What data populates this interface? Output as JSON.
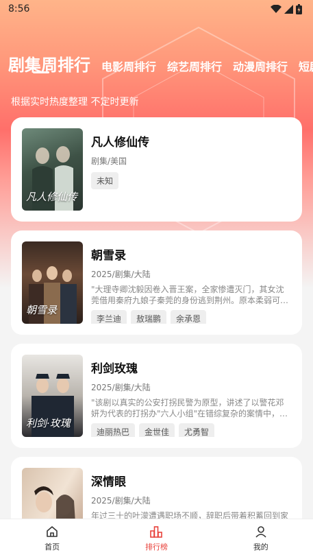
{
  "status_bar": {
    "time": "8:56"
  },
  "tabs": [
    {
      "label": "剧集周排行",
      "active": true
    },
    {
      "label": "电影周排行",
      "active": false
    },
    {
      "label": "综艺周排行",
      "active": false
    },
    {
      "label": "动漫周排行",
      "active": false
    },
    {
      "label": "短剧",
      "active": false
    }
  ],
  "subtitle": "根据实时热度整理 不定时更新",
  "items": [
    {
      "title": "凡人修仙传",
      "meta": "剧集/美国",
      "desc": "",
      "poster_text": "凡人修仙传",
      "tags": [
        "未知"
      ]
    },
    {
      "title": "朝雪录",
      "meta": "2025/剧集/大陆",
      "desc": "\"大理寺卿沈毅因卷入晋王案，全家惨遭灭门，其女沈莞借用秦府九娘子秦莞的身份逃到荆州。原本柔弱可…",
      "poster_text": "朝雪录",
      "tags": [
        "李兰迪",
        "敖瑞鹏",
        "余承恩"
      ]
    },
    {
      "title": "利剑玫瑰",
      "meta": "2025/剧集/大陆",
      "desc": "\"该剧以真实的公安打拐民警为原型，讲述了以警花邓妍为代表的打拐办\"六人小组\"在错综复杂的案情中，…",
      "poster_text": "利剑·玫瑰",
      "tags": [
        "迪丽热巴",
        "金世佳",
        "尤勇智"
      ]
    },
    {
      "title": "深情眼",
      "meta": "2025/剧集/大陆",
      "desc": "年过三十的叶濛遭遇职场不顺，辞职后带着积蓄回到家乡开启佛系的小镇生活，机缘巧合之下，她偶遇了…",
      "poster_text": "",
      "tags": []
    }
  ],
  "bottom_nav": [
    {
      "label": "首页",
      "icon": "home-icon",
      "active": false
    },
    {
      "label": "排行榜",
      "icon": "ranking-icon",
      "active": true
    },
    {
      "label": "我的",
      "icon": "profile-icon",
      "active": false
    }
  ],
  "colors": {
    "accent": "#e8413a",
    "gradient_top": "#ffb489",
    "gradient_mid": "#ff6f6a"
  }
}
